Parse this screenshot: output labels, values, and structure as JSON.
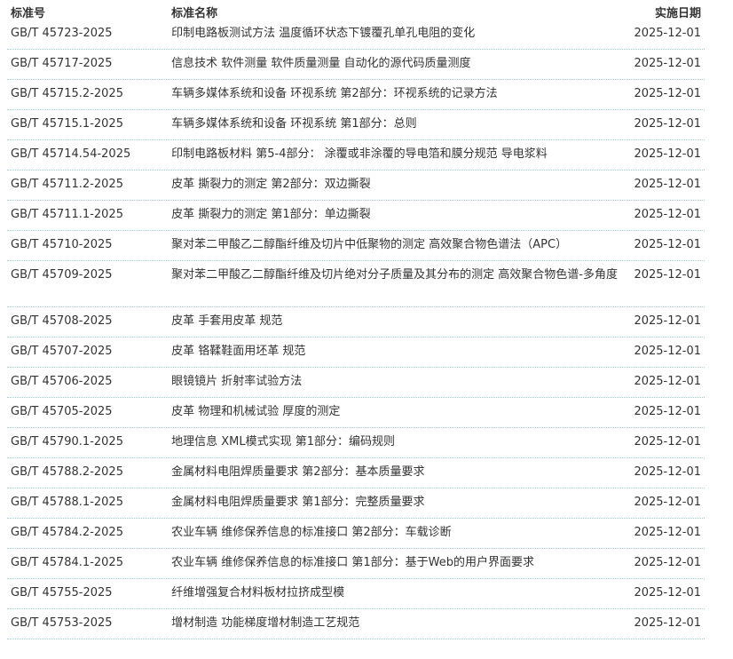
{
  "headers": {
    "code": "标准号",
    "name": "标准名称",
    "date": "实施日期"
  },
  "rows": [
    {
      "code": "GB/T 45723-2025",
      "name": "印制电路板测试方法 温度循环状态下镀覆孔单孔电阻的变化",
      "date": "2025-12-01"
    },
    {
      "code": "GB/T 45717-2025",
      "name": "信息技术 软件测量 软件质量测量 自动化的源代码质量测度",
      "date": "2025-12-01"
    },
    {
      "code": "GB/T 45715.2-2025",
      "name": "车辆多媒体系统和设备 环视系统 第2部分：环视系统的记录方法",
      "date": "2025-12-01"
    },
    {
      "code": "GB/T 45715.1-2025",
      "name": "车辆多媒体系统和设备 环视系统 第1部分：总则",
      "date": "2025-12-01"
    },
    {
      "code": "GB/T 45714.54-2025",
      "name": "印制电路板材料 第5-4部分： 涂覆或非涂覆的导电箔和膜分规范 导电浆料",
      "date": "2025-12-01"
    },
    {
      "code": "GB/T 45711.2-2025",
      "name": "皮革 撕裂力的测定 第2部分：双边撕裂",
      "date": "2025-12-01"
    },
    {
      "code": "GB/T 45711.1-2025",
      "name": "皮革 撕裂力的测定 第1部分：单边撕裂",
      "date": "2025-12-01"
    },
    {
      "code": "GB/T 45710-2025",
      "name": "聚对苯二甲酸乙二醇酯纤维及切片中低聚物的测定 高效聚合物色谱法（APC）",
      "date": "2025-12-01"
    },
    {
      "code": "GB/T 45709-2025",
      "name": "聚对苯二甲酸乙二醇酯纤维及切片绝对分子质量及其分布的测定 高效聚合物色谱-多角度",
      "date": "2025-12-01"
    },
    {
      "code": "GB/T 45708-2025",
      "name": "皮革 手套用皮革 规范",
      "date": "2025-12-01"
    },
    {
      "code": "GB/T 45707-2025",
      "name": "皮革 铬鞣鞋面用坯革 规范",
      "date": "2025-12-01"
    },
    {
      "code": "GB/T 45706-2025",
      "name": "眼镜镜片 折射率试验方法",
      "date": "2025-12-01"
    },
    {
      "code": "GB/T 45705-2025",
      "name": "皮革 物理和机械试验 厚度的测定",
      "date": "2025-12-01"
    },
    {
      "code": "GB/T 45790.1-2025",
      "name": "地理信息 XML模式实现 第1部分：编码规则",
      "date": "2025-12-01"
    },
    {
      "code": "GB/T 45788.2-2025",
      "name": "金属材料电阻焊质量要求 第2部分：基本质量要求",
      "date": "2025-12-01"
    },
    {
      "code": "GB/T 45788.1-2025",
      "name": "金属材料电阻焊质量要求 第1部分：完整质量要求",
      "date": "2025-12-01"
    },
    {
      "code": "GB/T 45784.2-2025",
      "name": "农业车辆 维修保养信息的标准接口 第2部分：车载诊断",
      "date": "2025-12-01"
    },
    {
      "code": "GB/T 45784.1-2025",
      "name": "农业车辆 维修保养信息的标准接口 第1部分：基于Web的用户界面要求",
      "date": "2025-12-01"
    },
    {
      "code": "GB/T 45755-2025",
      "name": "纤维增强复合材料板材拉挤成型模",
      "date": "2025-12-01"
    },
    {
      "code": "GB/T 45753-2025",
      "name": "增材制造 功能梯度增材制造工艺规范",
      "date": "2025-12-01"
    }
  ]
}
